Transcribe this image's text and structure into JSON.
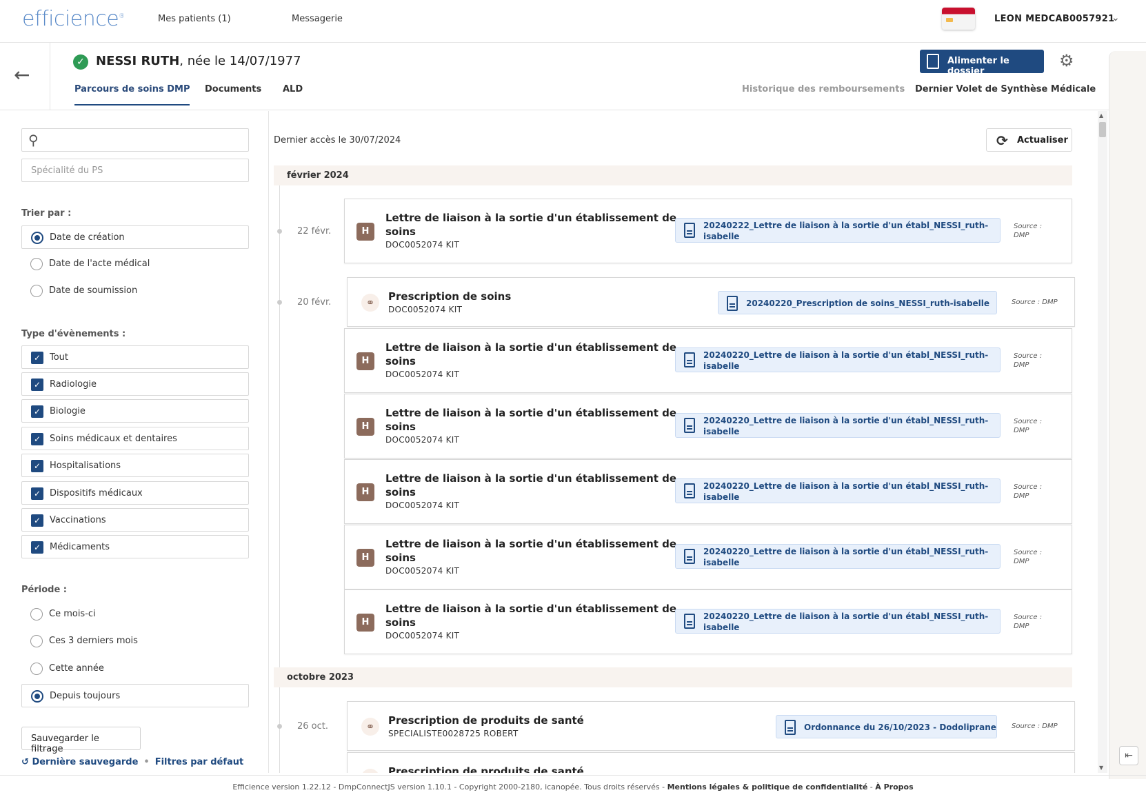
{
  "header": {
    "logo": "efficience",
    "nav": [
      "Mes patients (1)",
      "Messagerie"
    ],
    "user": "LEON MEDCAB0057921"
  },
  "patient": {
    "name": "NESSI RUTH",
    "birth": ", née le 14/07/1977",
    "tabs": [
      "Parcours de soins DMP",
      "Documents",
      "ALD"
    ],
    "right_tabs": [
      "Historique des remboursements",
      "Dernier Volet de Synthèse Médicale"
    ],
    "feed_button": "Alimenter le dossier"
  },
  "filters": {
    "search_placeholder": "",
    "specialty_placeholder": "Spécialité du PS",
    "sort_label": "Trier par :",
    "sort_options": [
      "Date de création",
      "Date de l'acte médical",
      "Date de soumission"
    ],
    "type_label": "Type d'évènements :",
    "types": [
      "Tout",
      "Radiologie",
      "Biologie",
      "Soins médicaux et dentaires",
      "Hospitalisations",
      "Dispositifs médicaux",
      "Vaccinations",
      "Médicaments"
    ],
    "period_label": "Période :",
    "periods": [
      "Ce mois-ci",
      "Ces 3 derniers mois",
      "Cette année",
      "Depuis toujours"
    ],
    "save_button": "Sauvegarder le filtrage",
    "last_save": "Dernière sauvegarde",
    "default_filters": "Filtres par défaut"
  },
  "main": {
    "last_access": "Dernier accès le 30/07/2024",
    "refresh": "Actualiser",
    "months": [
      "février 2024",
      "octobre 2023"
    ],
    "events": [
      {
        "date": "22 févr.",
        "badge": "H",
        "title1": "Lettre de liaison à la sortie d'un établissement de",
        "title2": "soins",
        "sub": "DOC0052074 KIT",
        "doc1": "20240222_Lettre de liaison à la sortie d'un établ_NESSI_ruth-",
        "doc2": "isabelle",
        "src1": "Source :",
        "src2": "DMP"
      },
      {
        "date": "20 févr.",
        "title1": "Prescription de soins",
        "sub": "DOC0052074 KIT",
        "doc1": "20240220_Prescription de soins_NESSI_ruth-isabelle",
        "src1": "Source : DMP"
      },
      {
        "badge": "H",
        "title1": "Lettre de liaison à la sortie d'un établissement de",
        "title2": "soins",
        "sub": "DOC0052074 KIT",
        "doc1": "20240220_Lettre de liaison à la sortie d'un établ_NESSI_ruth-",
        "doc2": "isabelle",
        "src1": "Source :",
        "src2": "DMP"
      },
      {
        "badge": "H",
        "title1": "Lettre de liaison à la sortie d'un établissement de",
        "title2": "soins",
        "sub": "DOC0052074 KIT",
        "doc1": "20240220_Lettre de liaison à la sortie d'un établ_NESSI_ruth-",
        "doc2": "isabelle",
        "src1": "Source :",
        "src2": "DMP"
      },
      {
        "badge": "H",
        "title1": "Lettre de liaison à la sortie d'un établissement de",
        "title2": "soins",
        "sub": "DOC0052074 KIT",
        "doc1": "20240220_Lettre de liaison à la sortie d'un établ_NESSI_ruth-",
        "doc2": "isabelle",
        "src1": "Source :",
        "src2": "DMP"
      },
      {
        "badge": "H",
        "title1": "Lettre de liaison à la sortie d'un établissement de",
        "title2": "soins",
        "sub": "DOC0052074 KIT",
        "doc1": "20240220_Lettre de liaison à la sortie d'un établ_NESSI_ruth-",
        "doc2": "isabelle",
        "src1": "Source :",
        "src2": "DMP"
      },
      {
        "badge": "H",
        "title1": "Lettre de liaison à la sortie d'un établissement de",
        "title2": "soins",
        "sub": "DOC0052074 KIT",
        "doc1": "20240220_Lettre de liaison à la sortie d'un établ_NESSI_ruth-",
        "doc2": "isabelle",
        "src1": "Source :",
        "src2": "DMP"
      },
      {
        "date": "26 oct.",
        "title1": "Prescription de produits de santé",
        "sub": "SPECIALISTE0028725 ROBERT",
        "doc1": "Ordonnance du 26/10/2023 - Dodoliprane",
        "src1": "Source : DMP"
      },
      {
        "title1": "Prescription de produits de santé"
      }
    ]
  },
  "footer": {
    "text": "Efficience version 1.22.12 - DmpConnectJS version 1.10.1 - Copyright 2000-2180, icanopée. Tous droits réservés - ",
    "legal": "Mentions légales & politique de confidentialité",
    "sep": " - ",
    "about": "À Propos"
  }
}
